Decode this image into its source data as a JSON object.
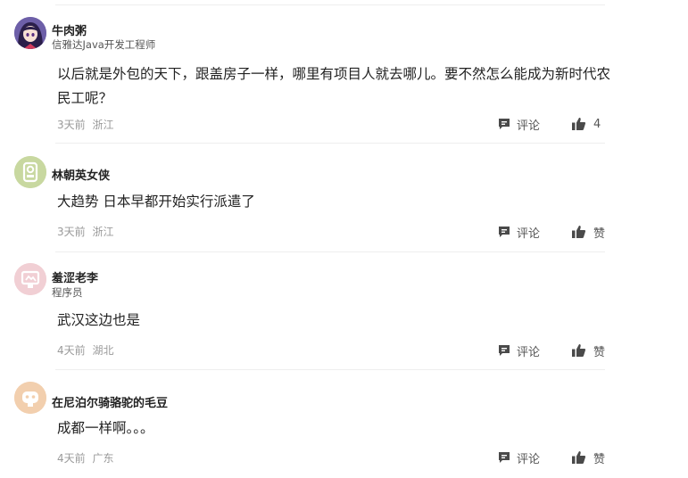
{
  "comments": [
    {
      "username": "牛肉粥",
      "title": "信雅达Java开发工程师",
      "content": "以后就是外包的天下，跟盖房子一样，哪里有项目人就去哪儿。要不然怎么能成为新时代农民工呢？",
      "time": "3天前",
      "location": "浙江",
      "reply_label": "评论",
      "like_label": "4",
      "avatar_icon": "anime-girl-avatar"
    },
    {
      "username": "林朝英女侠",
      "title": "",
      "content": "大趋势 日本早都开始实行派遣了",
      "time": "3天前",
      "location": "浙江",
      "reply_label": "评论",
      "like_label": "赞",
      "avatar_icon": "green-default-avatar"
    },
    {
      "username": "羞涩老李",
      "title": "程序员",
      "content": "武汉这边也是",
      "time": "4天前",
      "location": "湖北",
      "reply_label": "评论",
      "like_label": "赞",
      "avatar_icon": "pink-default-avatar"
    },
    {
      "username": "在尼泊尔骑骆驼的毛豆",
      "title": "",
      "content": "成都一样啊。。。",
      "time": "4天前",
      "location": "广东",
      "reply_label": "评论",
      "like_label": "赞",
      "avatar_icon": "orange-default-avatar"
    }
  ],
  "colors": {
    "text": "#222222",
    "meta": "#9a9a9a",
    "divider": "#eeeeee",
    "avatar_green": "#c8d8a0",
    "avatar_pink": "#f1cfd4",
    "avatar_orange": "#f2cfae"
  }
}
